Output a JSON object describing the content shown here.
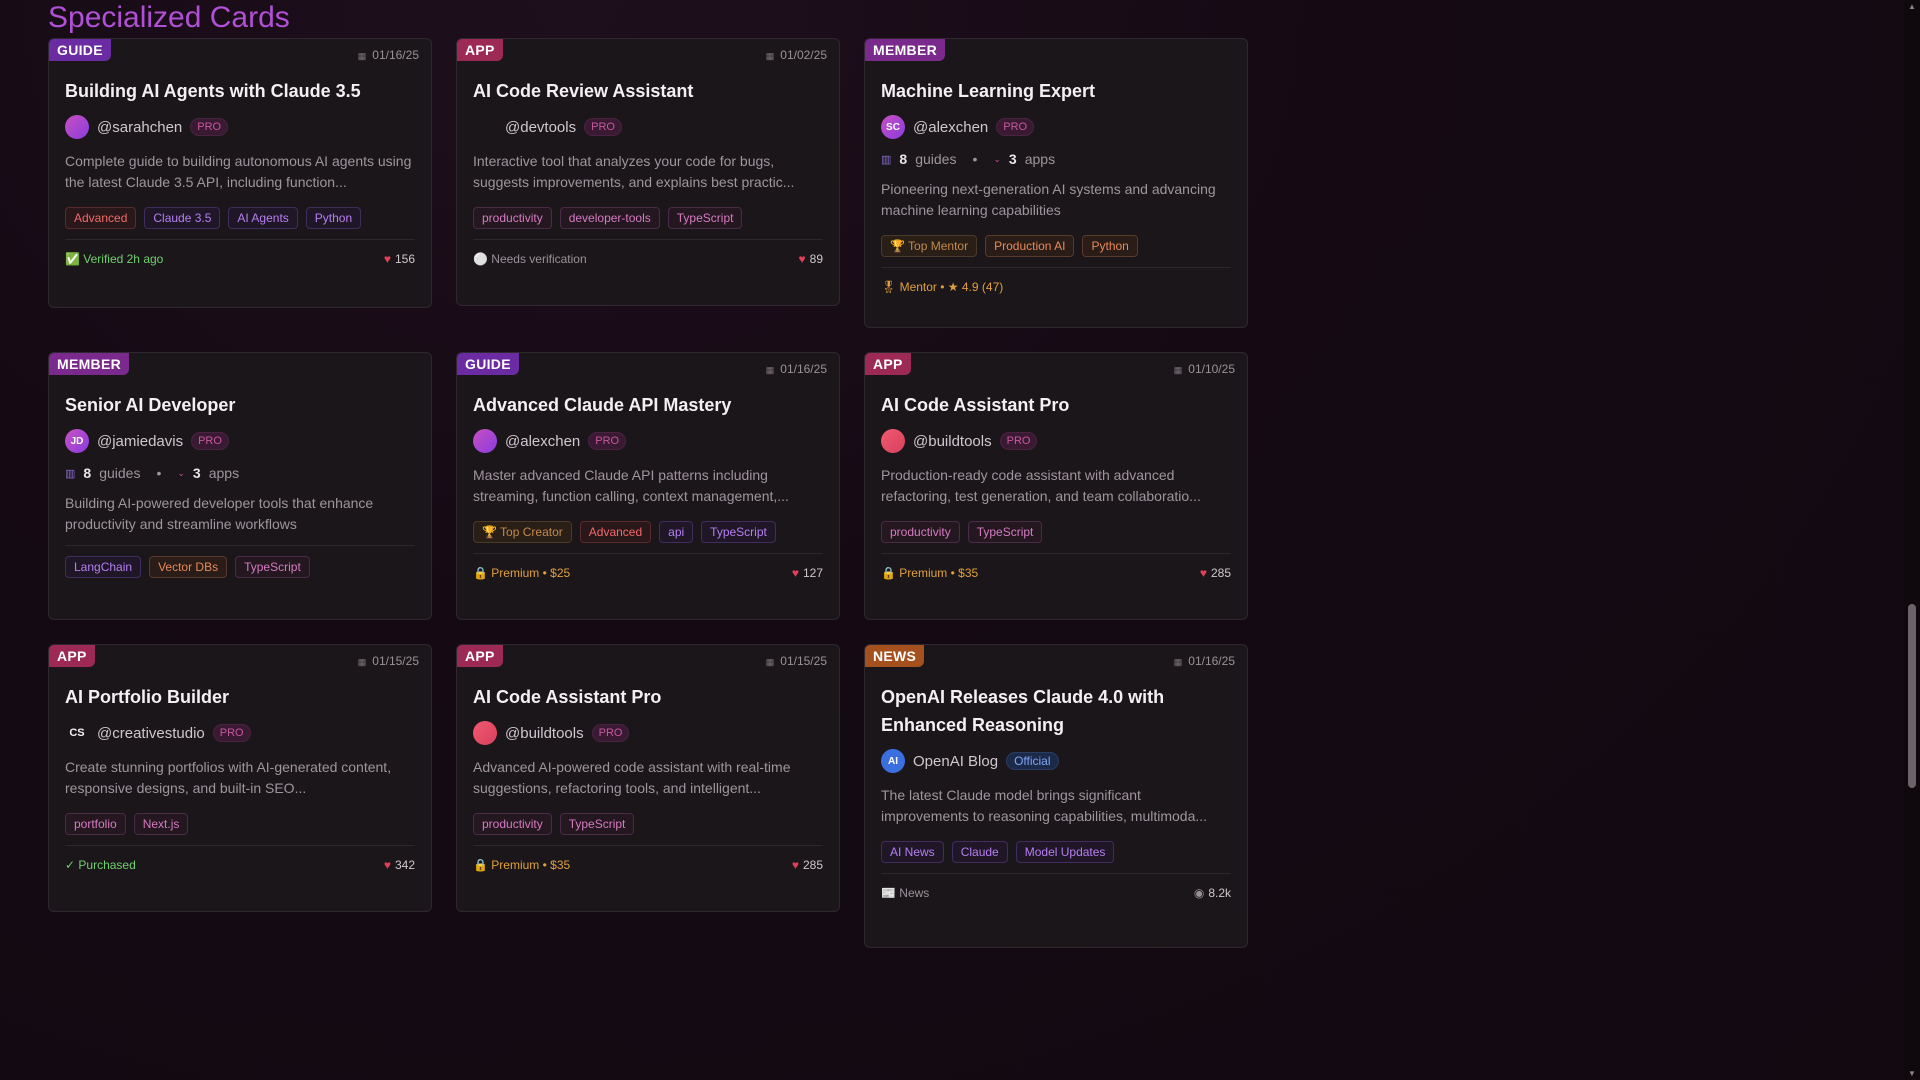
{
  "section_title": "Specialized Cards",
  "icons": {
    "calendar": "calendar-icon",
    "heart": "heart-icon",
    "lock": "lock-icon",
    "check": "check-icon",
    "eye": "eye-icon"
  },
  "cards": [
    {
      "type": "GUIDE",
      "date": "01/16/25",
      "title": "Building AI Agents with Claude 3.5",
      "author": "@sarahchen",
      "author_badge": "PRO",
      "description": "Complete guide to building autonomous AI agents using the latest Claude 3.5 API, including function...",
      "tags": [
        "Advanced",
        "Claude 3.5",
        "AI Agents",
        "Python"
      ],
      "footer": "✅ Verified 2h ago",
      "likes": "156"
    },
    {
      "type": "APP",
      "date": "01/02/25",
      "title": "AI Code Review Assistant",
      "author": "@devtools",
      "author_badge": "PRO",
      "description": "Interactive tool that analyzes your code for bugs, suggests improvements, and explains best practic...",
      "tags": [
        "productivity",
        "developer-tools",
        "TypeScript"
      ],
      "footer": "⚪ Needs verification",
      "likes": "89"
    },
    {
      "type": "MEMBER",
      "title": "Machine Learning Expert",
      "avatar_initials": "SC",
      "author": "@alexchen",
      "author_badge": "PRO",
      "guides_count": "8",
      "guides_label": "guides",
      "apps_count": "3",
      "apps_label": "apps",
      "description": "Pioneering next-generation AI systems and advancing machine learning capabilities",
      "tags": [
        "🏆 Top Mentor",
        "Production AI",
        "Python"
      ],
      "footer": "🎖 Mentor • ★ 4.9 (47)"
    },
    {
      "type": "MEMBER",
      "title": "Senior AI Developer",
      "avatar_initials": "JD",
      "author": "@jamiedavis",
      "author_badge": "PRO",
      "guides_count": "8",
      "guides_label": "guides",
      "apps_count": "3",
      "apps_label": "apps",
      "description": "Building AI-powered developer tools that enhance productivity and streamline workflows",
      "tags": [
        "LangChain",
        "Vector DBs",
        "TypeScript"
      ]
    },
    {
      "type": "GUIDE",
      "date": "01/16/25",
      "title": "Advanced Claude API Mastery",
      "author": "@alexchen",
      "author_badge": "PRO",
      "description": "Master advanced Claude API patterns including streaming, function calling, context management,...",
      "tags": [
        "🏆 Top Creator",
        "Advanced",
        "api",
        "TypeScript"
      ],
      "footer": "🔒 Premium • $25",
      "likes": "127"
    },
    {
      "type": "APP",
      "date": "01/10/25",
      "title": "AI Code Assistant Pro",
      "author": "@buildtools",
      "author_badge": "PRO",
      "description": "Production-ready code assistant with advanced refactoring, test generation, and team collaboratio...",
      "tags": [
        "productivity",
        "TypeScript"
      ],
      "footer": "🔒 Premium • $35",
      "likes": "285"
    },
    {
      "type": "APP",
      "date": "01/15/25",
      "title": "AI Portfolio Builder",
      "avatar_initials": "CS",
      "author": "@creativestudio",
      "author_badge": "PRO",
      "description": "Create stunning portfolios with AI-generated content, responsive designs, and built-in SEO...",
      "tags": [
        "portfolio",
        "Next.js"
      ],
      "footer": "✓ Purchased",
      "likes": "342"
    },
    {
      "type": "APP",
      "date": "01/15/25",
      "title": "AI Code Assistant Pro",
      "author": "@buildtools",
      "author_badge": "PRO",
      "description": "Advanced AI-powered code assistant with real-time suggestions, refactoring tools, and intelligent...",
      "tags": [
        "productivity",
        "TypeScript"
      ],
      "footer": "🔒 Premium • $35",
      "likes": "285"
    },
    {
      "type": "NEWS",
      "date": "01/16/25",
      "title": "OpenAI Releases Claude 4.0 with Enhanced Reasoning",
      "avatar_initials": "AI",
      "author": "OpenAI Blog",
      "author_badge": "Official",
      "description": "The latest Claude model brings significant improvements to reasoning capabilities, multimoda...",
      "tags": [
        "AI News",
        "Claude",
        "Model Updates"
      ],
      "footer": "📰 News",
      "views": "8.2k"
    }
  ]
}
